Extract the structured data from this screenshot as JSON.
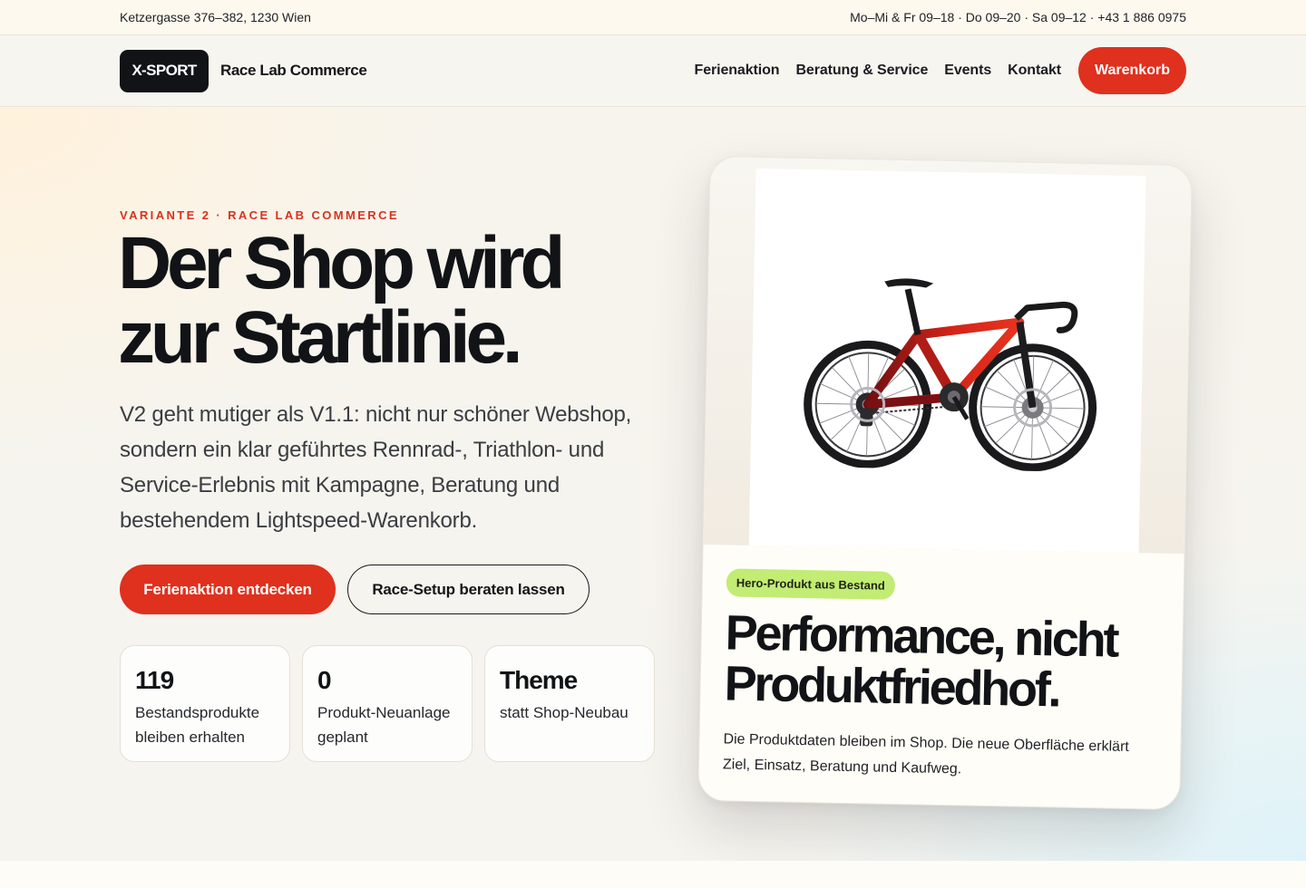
{
  "topbar": {
    "address": "Ketzergasse 376–382, 1230 Wien",
    "hours": "Mo–Mi & Fr 09–18 · Do 09–20 · Sa 09–12 · +43 1 886 0975"
  },
  "header": {
    "logo": "X-SPORT",
    "brand_name": "Race Lab Commerce",
    "nav": [
      "Ferienaktion",
      "Beratung & Service",
      "Events",
      "Kontakt"
    ],
    "cart_label": "Warenkorb"
  },
  "hero": {
    "eyebrow": "VARIANTE 2 · RACE LAB COMMERCE",
    "headline_line1": "Der Shop wird",
    "headline_line2": "zur Startlinie.",
    "lede": "V2 geht mutiger als V1.1: nicht nur schöner Webshop, sondern ein klar geführtes Rennrad-, Triathlon- und Service-Erlebnis mit Kampagne, Beratung und bestehendem Lightspeed-Warenkorb.",
    "cta_primary": "Ferienaktion entdecken",
    "cta_secondary": "Race-Setup beraten lassen",
    "stats": [
      {
        "value": "119",
        "label": "Bestandsprodukte bleiben erhalten"
      },
      {
        "value": "0",
        "label": "Produkt-Neuanlage geplant"
      },
      {
        "value": "Theme",
        "label": "statt Shop-Neubau"
      }
    ]
  },
  "product_card": {
    "image_icon": "road-bike-image",
    "badge": "Hero-Produkt aus Bestand",
    "title_line1": "Performance, nicht",
    "title_line2": "Produktfriedhof.",
    "description": "Die Produktdaten bleiben im Shop. Die neue Oberfläche erklärt Ziel, Einsatz, Beratung und Kaufweg."
  },
  "colors": {
    "accent_red": "#e0301e",
    "badge_green": "#c2ec74",
    "ink": "#111316"
  }
}
